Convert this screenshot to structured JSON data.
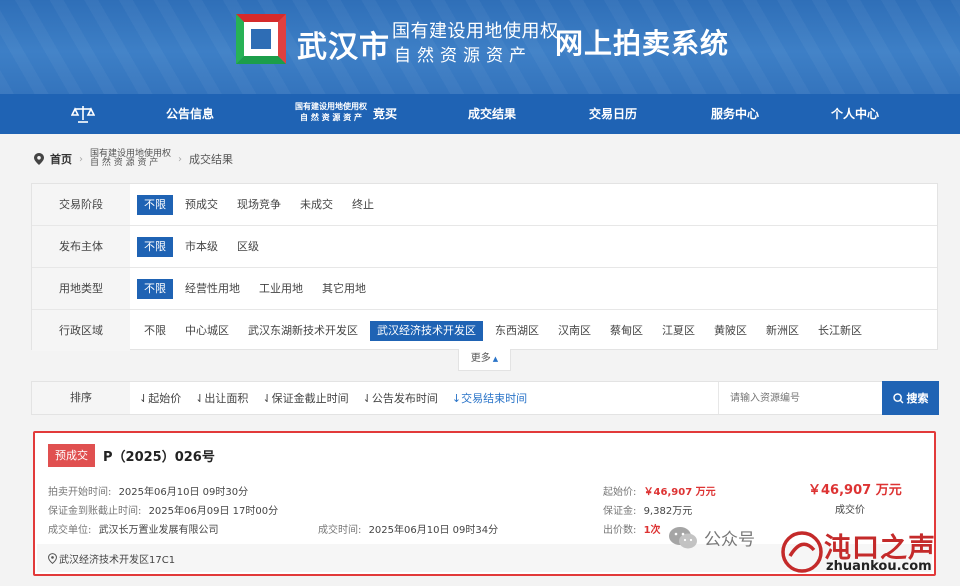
{
  "header": {
    "city": "武汉市",
    "sub_line1": "国有建设用地使用权",
    "sub_line2": "自然资源资产",
    "system_name": "网上拍卖系统",
    "colors": {
      "banner": "#3474bd",
      "nav": "#1f63b4",
      "accent": "#1f63b4",
      "alert": "#e23a3a"
    }
  },
  "nav": {
    "home_icon": "scale-icon",
    "items": [
      {
        "label": "公告信息"
      },
      {
        "label_line1": "国有建设用地使用权",
        "label_line2": "自 然 资 源 资 产",
        "label_suffix": "竞买"
      },
      {
        "label": "成交结果"
      },
      {
        "label": "交易日历"
      },
      {
        "label": "服务中心"
      },
      {
        "label": "个人中心"
      }
    ]
  },
  "breadcrumb": {
    "home": "首页",
    "middle_line1": "国有建设用地使用权",
    "middle_line2": "自 然 资 源 资 产",
    "current": "成交结果"
  },
  "filters": [
    {
      "label": "交易阶段",
      "options": [
        "不限",
        "预成交",
        "现场竞争",
        "未成交",
        "终止"
      ],
      "selected": 0
    },
    {
      "label": "发布主体",
      "options": [
        "不限",
        "市本级",
        "区级"
      ],
      "selected": 0
    },
    {
      "label": "用地类型",
      "options": [
        "不限",
        "经营性用地",
        "工业用地",
        "其它用地"
      ],
      "selected": 0
    },
    {
      "label": "行政区域",
      "options": [
        "不限",
        "中心城区",
        "武汉东湖新技术开发区",
        "武汉经济技术开发区",
        "东西湖区",
        "汉南区",
        "蔡甸区",
        "江夏区",
        "黄陂区",
        "新洲区",
        "长江新区"
      ],
      "selected": 3
    }
  ],
  "more_label": "更多",
  "sort": {
    "label": "排序",
    "options": [
      "⇃起始价",
      "⇃出让面积",
      "⇃保证金截止时间",
      "⇃公告发布时间",
      "↓交易结束时间"
    ],
    "active": 4,
    "search_placeholder": "请输入资源编号",
    "search_button": "搜索"
  },
  "result": {
    "tag": "预成交",
    "lot": "P（2025）026号",
    "start_label": "拍卖开始时间:",
    "start_value": "2025年06月10日 09时30分",
    "deposit_deadline_label": "保证金到账截止时间:",
    "deposit_deadline_value": "2025年06月09日 17时00分",
    "winner_label": "成交单位:",
    "winner_value": "武汉长万置业发展有限公司",
    "deal_time_label": "成交时间:",
    "deal_time_value": "2025年06月10日 09时34分",
    "start_price_label": "起始价:",
    "start_price_value": "￥46,907 万元",
    "deposit_label": "保证金:",
    "deposit_value": "9,382万元",
    "bids_label": "出价数:",
    "bids_value": "1次",
    "final_price": "￥46,907 万元",
    "final_price_label": "成交价",
    "location": "武汉经济技术开发区17C1"
  },
  "watermark": {
    "left": "公众号",
    "brand_zh": "沌口之声",
    "brand_en": "zhuankou.com"
  }
}
